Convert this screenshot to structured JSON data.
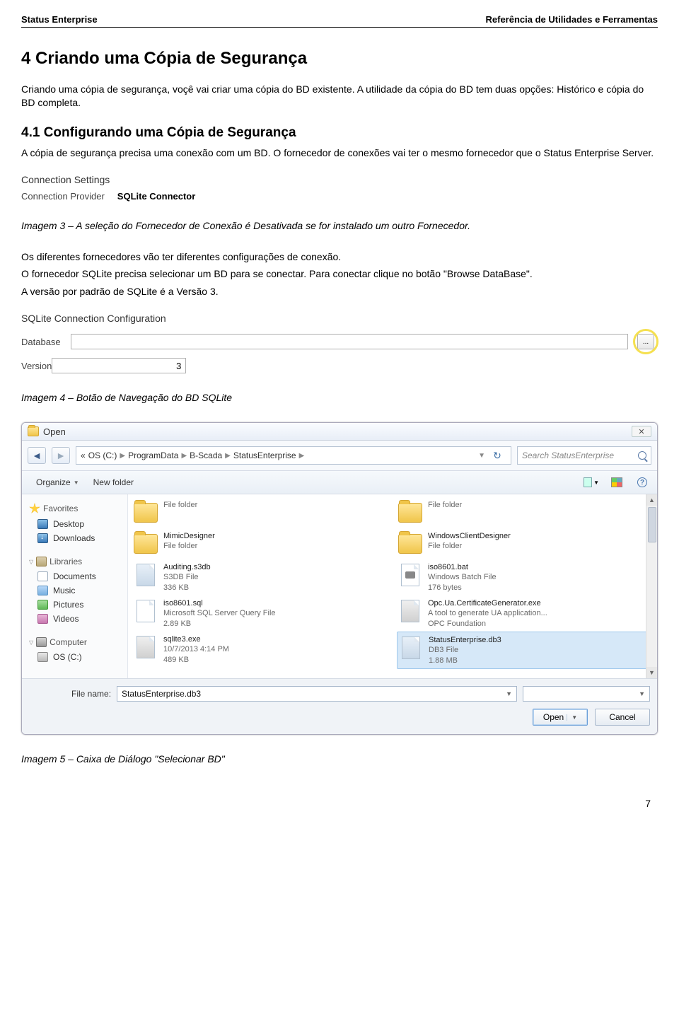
{
  "header": {
    "left": "Status Enterprise",
    "right": "Referência de Utilidades e Ferramentas"
  },
  "h1": "4   Criando uma Cópia de Segurança",
  "p1": "Criando uma cópia de segurança, voçê vai criar uma cópia do BD existente. A utilidade da cópia do BD tem duas opções: Histórico e cópia do BD completa.",
  "h2": "4.1   Configurando uma Cópia de Segurança",
  "p2": "A cópia de segurança precisa uma conexão com um BD. O fornecedor de conexões vai ter o mesmo fornecedor que o Status Enterprise Server.",
  "conn": {
    "title": "Connection Settings",
    "label": "Connection Provider",
    "value": "SQLite Connector"
  },
  "cap3": "Imagem 3 – A seleção do Fornecedor de Conexão é Desativada se for instalado um outro Fornecedor.",
  "p3": "Os diferentes fornecedores vão ter diferentes configurações de conexão.",
  "p4": "O fornecedor SQLite precisa selecionar um BD para se conectar. Para conectar clique no botão \"Browse DataBase\".",
  "p5": "A versão por padrão de SQLite é a Versão 3.",
  "sqlite": {
    "title": "SQLite Connection Configuration",
    "db_label": "Database",
    "db_value": "",
    "ver_label": "Version",
    "ver_value": "3",
    "browse": "..."
  },
  "cap4": "Imagem 4 – Botão de Navegação do BD SQLite",
  "dialog": {
    "title": "Open",
    "close": "✕",
    "nav_back": "◄",
    "nav_fwd": "►",
    "breadcrumb": [
      "«",
      "OS (C:)",
      "ProgramData",
      "B-Scada",
      "StatusEnterprise"
    ],
    "refresh": "↻",
    "search_placeholder": "Search StatusEnterprise",
    "toolbar": {
      "organize": "Organize",
      "newfolder": "New folder"
    },
    "sidebar": {
      "favorites": "Favorites",
      "fav_items": [
        "Desktop",
        "Downloads"
      ],
      "libraries": "Libraries",
      "lib_items": [
        "Documents",
        "Music",
        "Pictures",
        "Videos"
      ],
      "computer": "Computer",
      "comp_items": [
        "OS (C:)"
      ]
    },
    "files_left": [
      {
        "name": "",
        "meta1": "File folder",
        "meta2": "",
        "type": "folder"
      },
      {
        "name": "MimicDesigner",
        "meta1": "File folder",
        "meta2": "",
        "type": "folder"
      },
      {
        "name": "Auditing.s3db",
        "meta1": "S3DB File",
        "meta2": "336 KB",
        "type": "db"
      },
      {
        "name": "iso8601.sql",
        "meta1": "Microsoft SQL Server Query File",
        "meta2": "2.89 KB",
        "type": "sql"
      },
      {
        "name": "sqlite3.exe",
        "meta1": "10/7/2013 4:14 PM",
        "meta2": "489 KB",
        "type": "exe"
      }
    ],
    "files_right": [
      {
        "name": "",
        "meta1": "File folder",
        "meta2": "",
        "type": "folder"
      },
      {
        "name": "WindowsClientDesigner",
        "meta1": "File folder",
        "meta2": "",
        "type": "folder"
      },
      {
        "name": "iso8601.bat",
        "meta1": "Windows Batch File",
        "meta2": "176 bytes",
        "type": "bat"
      },
      {
        "name": "Opc.Ua.CertificateGenerator.exe",
        "meta1": "A tool to generate UA application...",
        "meta2": "OPC Foundation",
        "type": "exe"
      },
      {
        "name": "StatusEnterprise.db3",
        "meta1": "DB3 File",
        "meta2": "1.88 MB",
        "type": "db",
        "selected": true
      }
    ],
    "filename_label": "File name:",
    "filename_value": "StatusEnterprise.db3",
    "open_btn": "Open",
    "cancel_btn": "Cancel"
  },
  "cap5": "Imagem 5 – Caixa de Diálogo \"Selecionar BD\"",
  "page_number": "7"
}
